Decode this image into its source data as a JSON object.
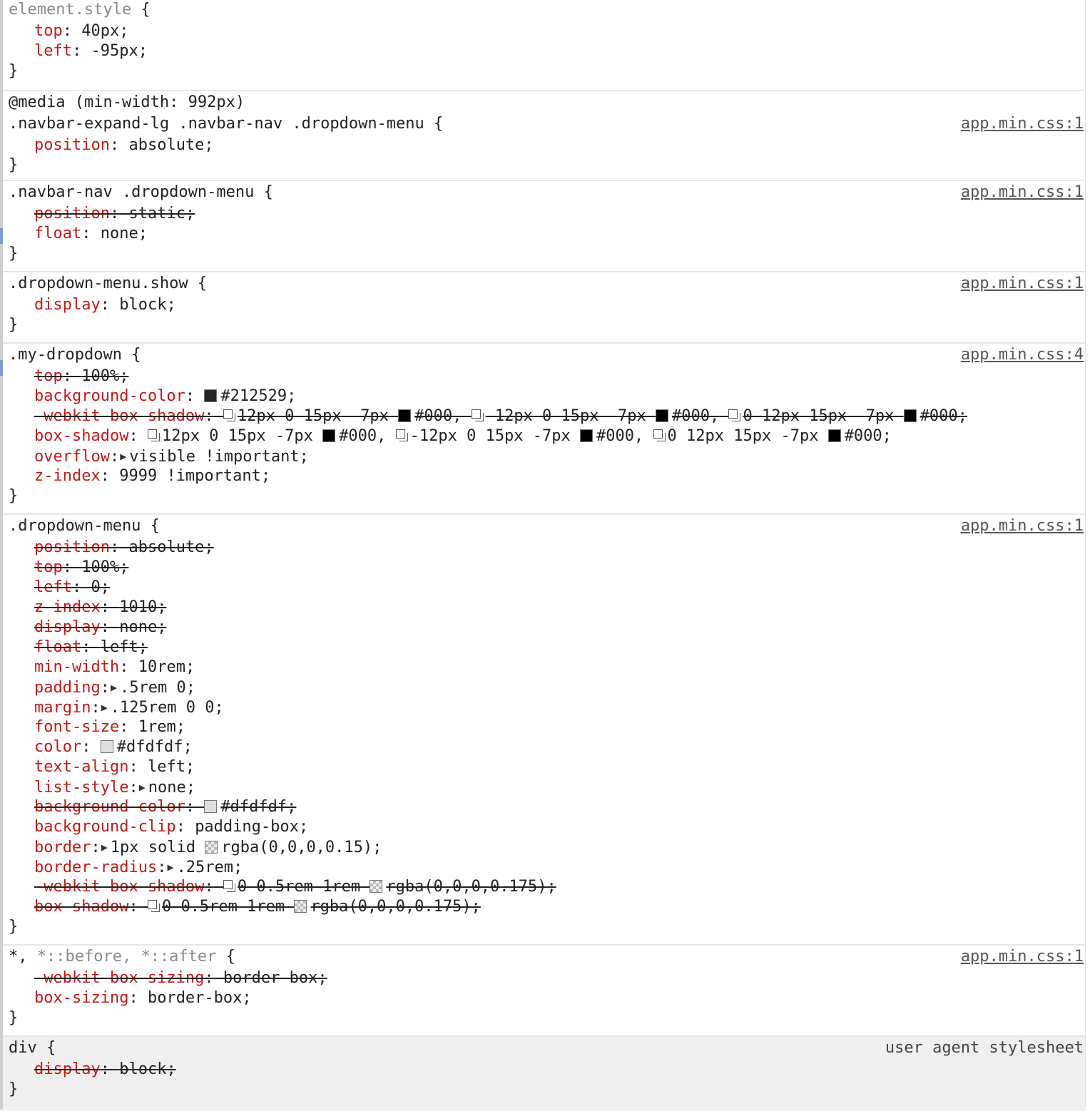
{
  "rules": [
    {
      "selector": "element.style",
      "brace_open": " {",
      "source": "",
      "declarations": [
        {
          "name": "top",
          "value": "40px;"
        },
        {
          "name": "left",
          "value": "-95px;"
        }
      ]
    },
    {
      "media": "@media (min-width: 992px)",
      "selector": ".navbar-expand-lg .navbar-nav .dropdown-menu",
      "brace_open": " {",
      "source": "app.min.css:1",
      "declarations": [
        {
          "name": "position",
          "value": "absolute;"
        }
      ]
    },
    {
      "selector": ".navbar-nav .dropdown-menu",
      "brace_open": " {",
      "source": "app.min.css:1",
      "declarations": [
        {
          "name": "position",
          "value": "static;",
          "overridden": true
        },
        {
          "name": "float",
          "value": "none;"
        }
      ]
    },
    {
      "selector": ".dropdown-menu.show",
      "brace_open": " {",
      "source": "app.min.css:1",
      "declarations": [
        {
          "name": "display",
          "value": "block;"
        }
      ]
    },
    {
      "selector": ".my-dropdown",
      "brace_open": " {",
      "source": "app.min.css:4",
      "declarations": [
        {
          "name": "top",
          "value": "100%;",
          "overridden": true
        },
        {
          "name": "background-color",
          "value": "#212529;",
          "swatch": "#212529"
        },
        {
          "name": "-webkit-box-shadow",
          "overridden": true,
          "shadows": [
            {
              "text": "12px 0 15px -7px",
              "color_text": "#000,",
              "color": "#000000"
            },
            {
              "text": "-12px 0 15px -7px",
              "color_text": "#000,",
              "color": "#000000"
            },
            {
              "text": "0 12px 15px -7px",
              "color_text": "#000;",
              "color": "#000000"
            }
          ]
        },
        {
          "name": "box-shadow",
          "shadows": [
            {
              "text": "12px 0 15px -7px",
              "color_text": "#000,",
              "color": "#000000"
            },
            {
              "text": "-12px 0 15px -7px",
              "color_text": "#000,",
              "color": "#000000"
            },
            {
              "text": "0 12px 15px -7px",
              "color_text": "#000;",
              "color": "#000000"
            }
          ]
        },
        {
          "name": "overflow",
          "value": "visible !important;",
          "expandable": true
        },
        {
          "name": "z-index",
          "value": "9999 !important;"
        }
      ]
    },
    {
      "selector": ".dropdown-menu",
      "brace_open": " {",
      "source": "app.min.css:1",
      "declarations": [
        {
          "name": "position",
          "value": "absolute;",
          "overridden": true
        },
        {
          "name": "top",
          "value": "100%;",
          "overridden": true
        },
        {
          "name": "left",
          "value": "0;",
          "overridden": true
        },
        {
          "name": "z-index",
          "value": "1010;",
          "overridden": true
        },
        {
          "name": "display",
          "value": "none;",
          "overridden": true
        },
        {
          "name": "float",
          "value": "left;",
          "overridden": true
        },
        {
          "name": "min-width",
          "value": "10rem;"
        },
        {
          "name": "padding",
          "value": ".5rem 0;",
          "expandable": true
        },
        {
          "name": "margin",
          "value": ".125rem 0 0;",
          "expandable": true
        },
        {
          "name": "font-size",
          "value": "1rem;"
        },
        {
          "name": "color",
          "value": "#dfdfdf;",
          "swatch": "#dfdfdf"
        },
        {
          "name": "text-align",
          "value": "left;"
        },
        {
          "name": "list-style",
          "value": "none;",
          "expandable": true
        },
        {
          "name": "background-color",
          "value": "#dfdfdf;",
          "swatch": "#dfdfdf",
          "overridden": true
        },
        {
          "name": "background-clip",
          "value": "padding-box;"
        },
        {
          "name": "border",
          "value_pre": "1px solid",
          "value": "rgba(0,0,0,0.15);",
          "swatch": "rgba(0,0,0,0.15)",
          "checker": true,
          "expandable": true
        },
        {
          "name": "border-radius",
          "value": ".25rem;",
          "expandable": true
        },
        {
          "name": "-webkit-box-shadow",
          "overridden": true,
          "shadows": [
            {
              "text": "0 0.5rem 1rem",
              "color_text": "rgba(0,0,0,0.175);",
              "color": "rgba(0,0,0,0.175)",
              "checker": true
            }
          ]
        },
        {
          "name": "box-shadow",
          "overridden": true,
          "shadows": [
            {
              "text": "0 0.5rem 1rem",
              "color_text": "rgba(0,0,0,0.175);",
              "color": "rgba(0,0,0,0.175)",
              "checker": true
            }
          ]
        }
      ]
    },
    {
      "selector": "*,",
      "selector_dim": " *::before, *::after",
      "brace_open": " {",
      "source": "app.min.css:1",
      "declarations": [
        {
          "name": "-webkit-box-sizing",
          "value": "border-box;",
          "overridden": true
        },
        {
          "name": "box-sizing",
          "value": "border-box;"
        }
      ]
    },
    {
      "selector": "div",
      "brace_open": " {",
      "source": "user agent stylesheet",
      "user_agent": true,
      "declarations": [
        {
          "name": "display",
          "value": "block;",
          "overridden": true
        }
      ]
    }
  ],
  "brace_close": "}"
}
